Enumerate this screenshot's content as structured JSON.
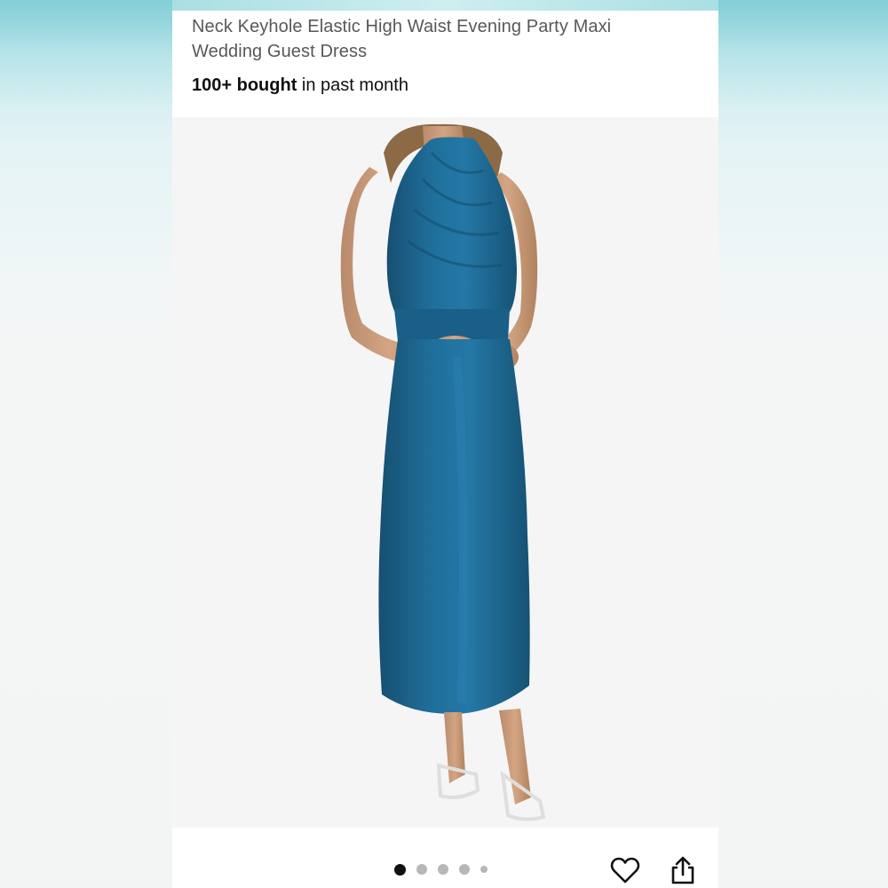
{
  "product": {
    "title_line1": "Neck Keyhole Elastic High Waist Evening Party Maxi",
    "title_line2": "Wedding Guest Dress",
    "bought_count": "100+ bought",
    "bought_suffix": " in past month"
  },
  "image": {
    "subject": "dress-photo",
    "dress_color": "#1d6a96",
    "background_color": "#f5f5f5"
  },
  "carousel": {
    "total_images": 5,
    "active_index": 0
  },
  "icons": {
    "wishlist": "heart-icon",
    "share": "share-icon"
  },
  "colors": {
    "title_text": "#565959",
    "body_text": "#0f1111",
    "dot_active": "#111111",
    "dot_inactive": "#b7b7b7"
  }
}
